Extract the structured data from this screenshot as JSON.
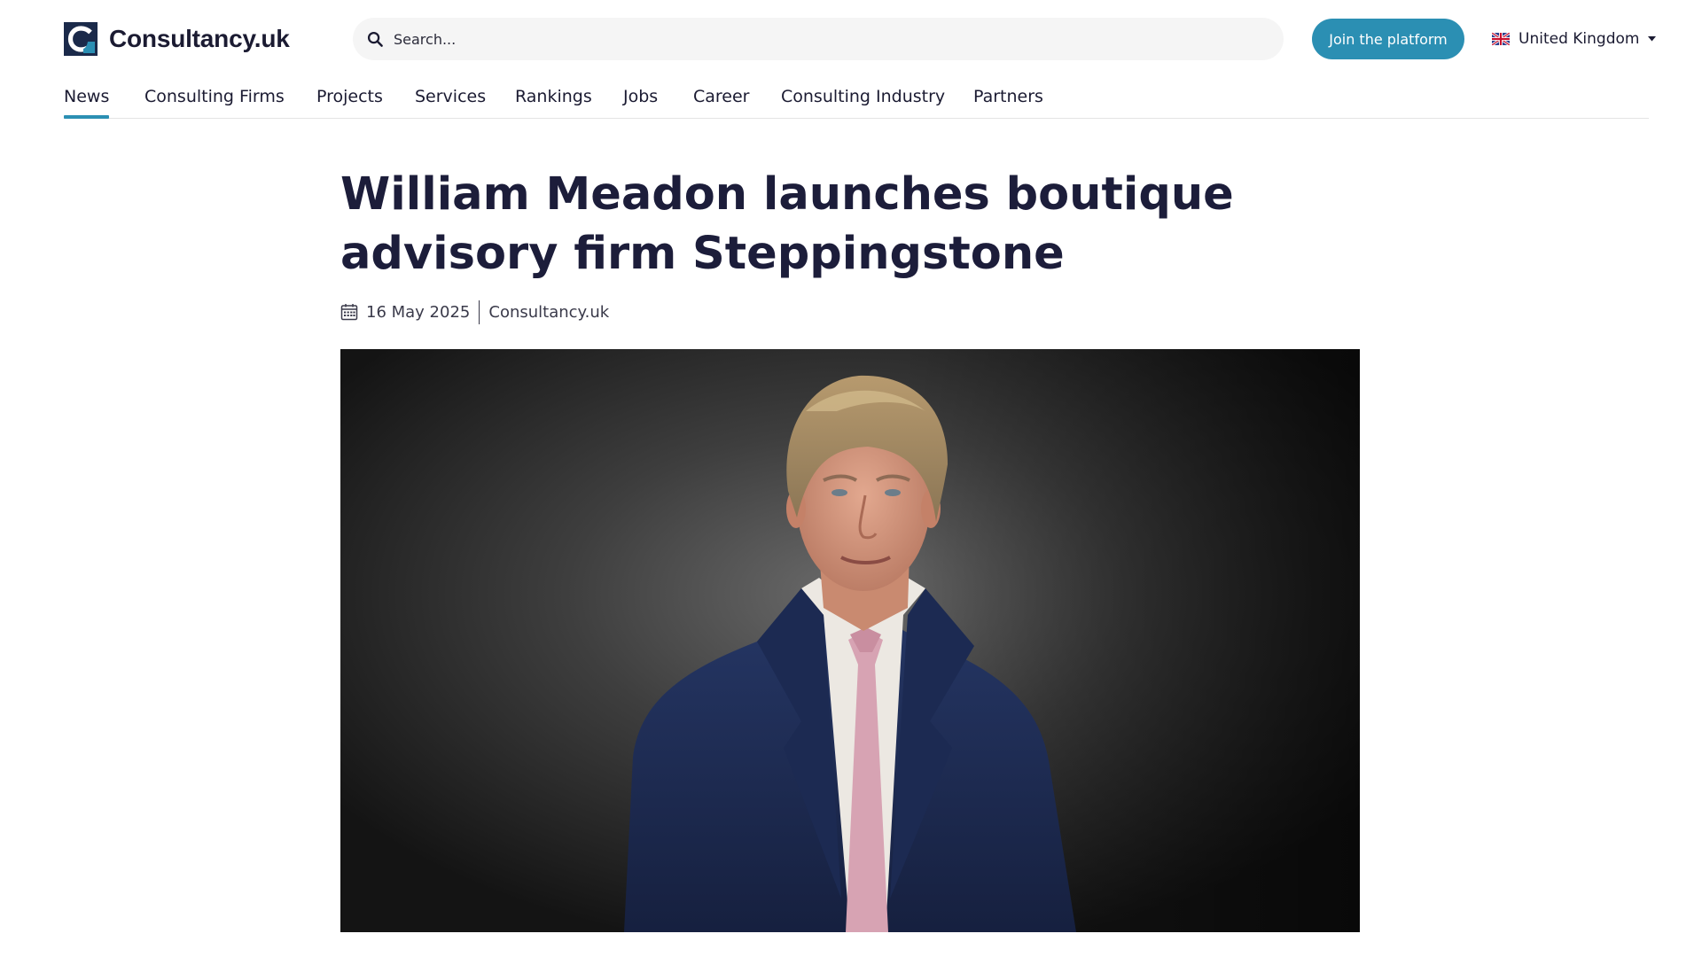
{
  "header": {
    "logo_text": "Consultancy.uk",
    "search": {
      "placeholder": "Search..."
    },
    "join_label": "Join the platform",
    "region_label": "United Kingdom"
  },
  "nav": {
    "items": [
      {
        "label": "News",
        "active": true
      },
      {
        "label": "Consulting Firms"
      },
      {
        "label": "Projects"
      },
      {
        "label": "Services"
      },
      {
        "label": "Rankings"
      },
      {
        "label": "Jobs"
      },
      {
        "label": "Career"
      },
      {
        "label": "Consulting Industry"
      },
      {
        "label": "Partners"
      }
    ]
  },
  "article": {
    "title": "William Meadon launches boutique advisory firm Steppingstone",
    "date": "16 May 2025",
    "source": "Consultancy.uk"
  },
  "icons": {
    "logo": "consultancy-logo-icon",
    "search": "search-icon",
    "flag": "uk-flag-icon",
    "caret": "caret-down-icon",
    "calendar": "calendar-icon"
  },
  "colors": {
    "accent": "#2b8fb3",
    "logo_dark": "#1b2a4a",
    "title": "#1c1d3a"
  }
}
